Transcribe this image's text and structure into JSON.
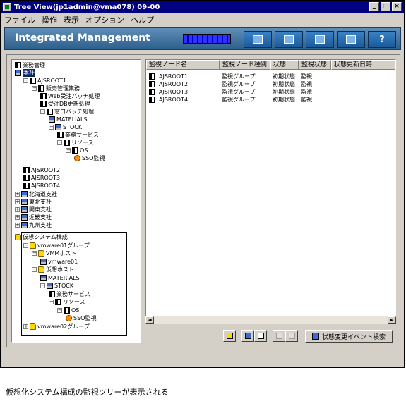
{
  "window": {
    "title": "Tree View(jp1admin@vma078) 09-00",
    "controls": [
      "_",
      "□",
      "×"
    ]
  },
  "menu": [
    "ファイル",
    "操作",
    "表示",
    "オプション",
    "ヘルプ"
  ],
  "banner": {
    "title": "Integrated Management",
    "buttons": [
      "book-icon",
      "monitor-icon",
      "system-icon",
      "window-icon",
      "help-icon"
    ],
    "help_label": "?"
  },
  "tree": [
    {
      "label": "業務管理",
      "icon": "book-icon",
      "expander": ""
    },
    {
      "label": "本社",
      "icon": "pc-icon",
      "expander": "",
      "selected": true
    },
    {
      "label": "AJSROOT1",
      "icon": "book-icon",
      "expander": "−"
    },
    {
      "label": "販売管理業務",
      "icon": "book-icon",
      "expander": "−"
    },
    {
      "label": "Web受注バッチ処理",
      "icon": "book-icon",
      "expander": ""
    },
    {
      "label": "受注DB更新処理",
      "icon": "book-icon",
      "expander": ""
    },
    {
      "label": "窓口バッチ処理",
      "icon": "book-icon",
      "expander": "−"
    },
    {
      "label": "MATELIALS",
      "icon": "pc-icon",
      "expander": ""
    },
    {
      "label": "STOCK",
      "icon": "pc-icon",
      "expander": "−"
    },
    {
      "label": "業務サービス",
      "icon": "book-icon",
      "expander": ""
    },
    {
      "label": "リソース",
      "icon": "book-icon",
      "expander": "−"
    },
    {
      "label": "OS",
      "icon": "book-icon",
      "expander": "−"
    },
    {
      "label": "SSO監視",
      "icon": "server-icon",
      "expander": ""
    },
    {
      "label": "AJSROOT2",
      "icon": "book-icon",
      "expander": ""
    },
    {
      "label": "AJSROOT3",
      "icon": "book-icon",
      "expander": ""
    },
    {
      "label": "AJSROOT4",
      "icon": "book-icon",
      "expander": ""
    },
    {
      "label": "北海道支社",
      "icon": "pc-icon",
      "expander": "+"
    },
    {
      "label": "東北支社",
      "icon": "pc-icon",
      "expander": "+"
    },
    {
      "label": "関東支社",
      "icon": "pc-icon",
      "expander": "+"
    },
    {
      "label": "近畿支社",
      "icon": "pc-icon",
      "expander": "+"
    },
    {
      "label": "九州支社",
      "icon": "pc-icon",
      "expander": "+"
    },
    {
      "label": "仮想システム構成",
      "icon": "folder-icon",
      "expander": ""
    },
    {
      "label": "vmware01グループ",
      "icon": "folder-icon",
      "expander": "−"
    },
    {
      "label": "VMMホスト",
      "icon": "folder-icon",
      "expander": "−"
    },
    {
      "label": "vmware01",
      "icon": "pc-icon",
      "expander": ""
    },
    {
      "label": "仮想ホスト",
      "icon": "folder-icon",
      "expander": "−"
    },
    {
      "label": "MATERIALS",
      "icon": "pc-icon",
      "expander": ""
    },
    {
      "label": "STOCK",
      "icon": "pc-icon",
      "expander": "−"
    },
    {
      "label": "業務サービス",
      "icon": "book-icon",
      "expander": ""
    },
    {
      "label": "リソース",
      "icon": "book-icon",
      "expander": "−"
    },
    {
      "label": "OS",
      "icon": "book-icon",
      "expander": "−"
    },
    {
      "label": "SSO監視",
      "icon": "server-icon",
      "expander": ""
    },
    {
      "label": "vmware02グループ",
      "icon": "folder-icon",
      "expander": "+"
    }
  ],
  "list": {
    "columns": [
      "監視ノード名",
      "監視ノード種別",
      "状態",
      "監視状態",
      "状態更新日時"
    ],
    "rows": [
      [
        "AJSROOT1",
        "監視グループ",
        "初期状態",
        "監視",
        ""
      ],
      [
        "AJSROOT2",
        "監視グループ",
        "初期状態",
        "監視",
        ""
      ],
      [
        "AJSROOT3",
        "監視グループ",
        "初期状態",
        "監視",
        ""
      ],
      [
        "AJSROOT4",
        "監視グループ",
        "初期状態",
        "監視",
        ""
      ]
    ]
  },
  "toolbar": {
    "event_button": "状態変更イベント検索"
  },
  "caption": "仮想化システム構成の監視ツリーが表示される"
}
